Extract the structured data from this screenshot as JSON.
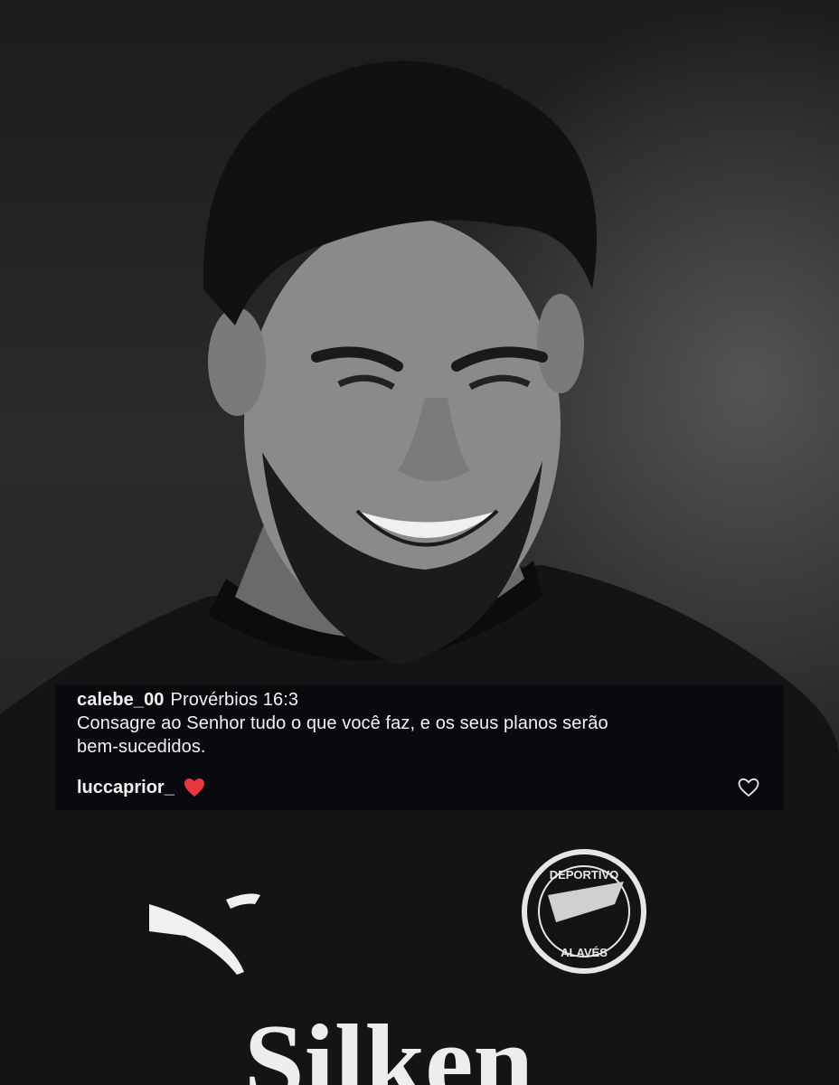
{
  "post": {
    "image_alt": "Black and white photo of a smiling footballer in a Deportivo Alavés training shirt",
    "shirt_sponsor": "Silken",
    "crest_text_top": "DEPORTIVO",
    "crest_text_bottom": "ALAVÉS"
  },
  "comment": {
    "username": "calebe_00",
    "text_line1": "Provérbios 16:3",
    "text_line2": "Consagre ao Senhor tudo o que você faz, e os seus planos serão",
    "text_line3": "bem-sucedidos."
  },
  "reply": {
    "username": "luccaprior_",
    "emoji_icon": "red-heart-emoji",
    "like_icon": "heart-outline-icon"
  },
  "colors": {
    "overlay_bg": "#080a0e",
    "text": "#f2f2f2",
    "heart_red": "#e8363f"
  }
}
